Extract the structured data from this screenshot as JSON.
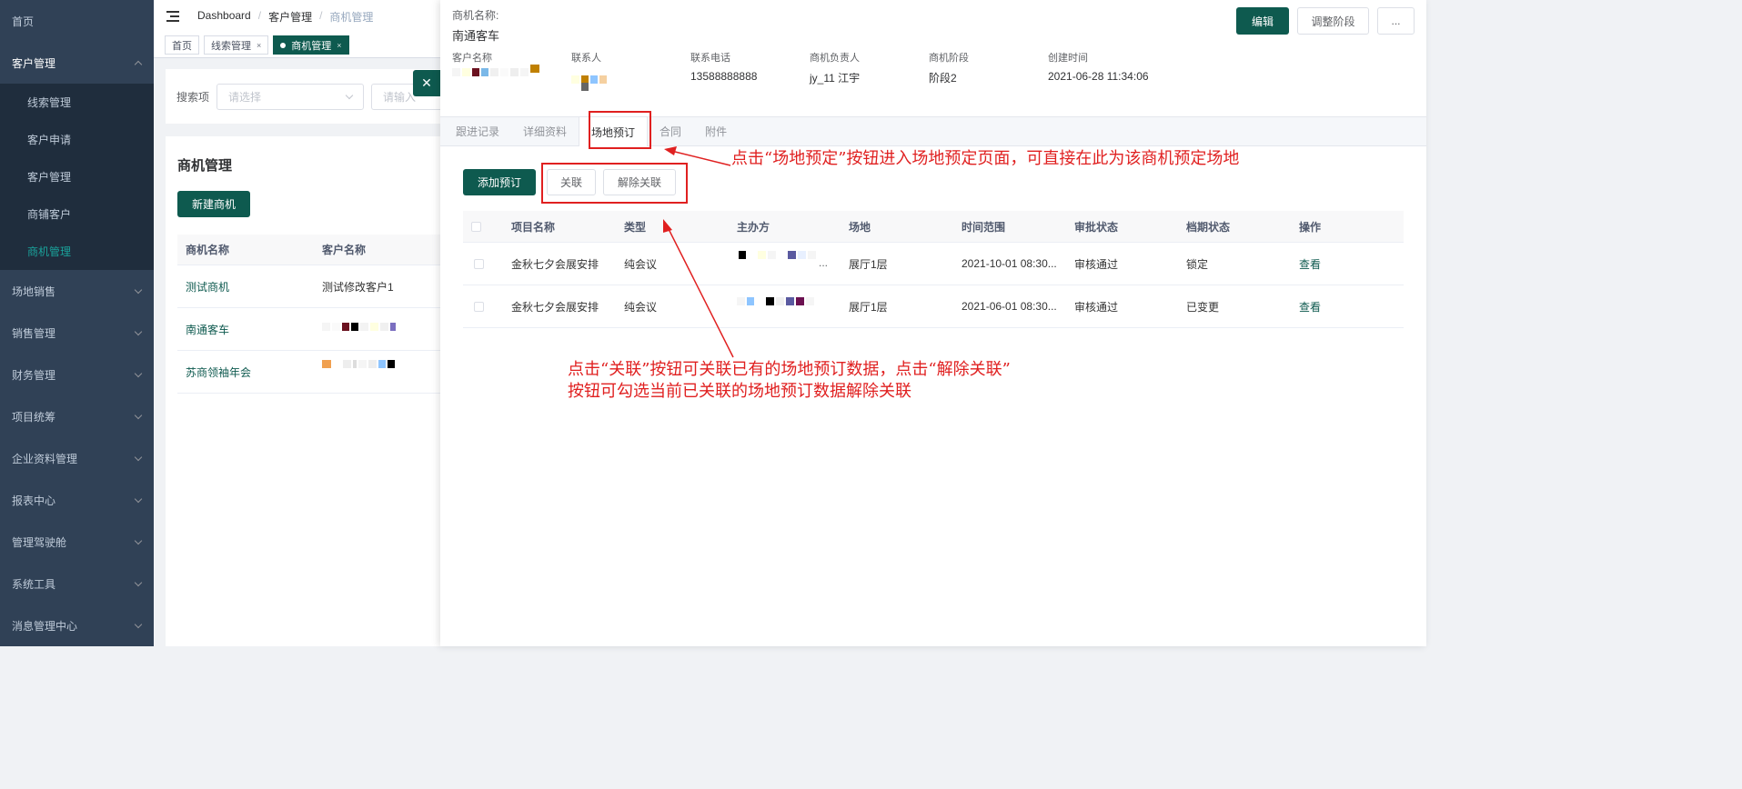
{
  "sidebar": {
    "items": [
      {
        "label": "首页"
      },
      {
        "label": "客户管理",
        "expanded": true
      },
      {
        "label": "场地销售"
      },
      {
        "label": "销售管理"
      },
      {
        "label": "财务管理"
      },
      {
        "label": "项目统筹"
      },
      {
        "label": "企业资料管理"
      },
      {
        "label": "报表中心"
      },
      {
        "label": "管理驾驶舱"
      },
      {
        "label": "系统工具"
      },
      {
        "label": "消息管理中心"
      }
    ],
    "submenu": [
      "线索管理",
      "客户申请",
      "客户管理",
      "商铺客户",
      "商机管理"
    ]
  },
  "breadcrumb": [
    "Dashboard",
    "客户管理",
    "商机管理"
  ],
  "tags": [
    "首页",
    "线索管理",
    "商机管理"
  ],
  "search": {
    "label": "搜索项",
    "select_placeholder": "请选择",
    "input_placeholder": "请输入"
  },
  "list": {
    "title": "商机管理",
    "new_button": "新建商机",
    "headers": [
      "商机名称",
      "客户名称"
    ],
    "rows": [
      {
        "name": "测试商机",
        "customer": "测试修改客户1"
      },
      {
        "name": "南通客车",
        "customer": ""
      },
      {
        "name": "苏商领袖年会",
        "customer": ""
      }
    ]
  },
  "drawer": {
    "name_label": "商机名称:",
    "name_value": "南通客车",
    "buttons": {
      "edit": "编辑",
      "adjust": "调整阶段",
      "more": "..."
    },
    "fields": {
      "customer_label": "客户名称",
      "contact_label": "联系人",
      "phone_label": "联系电话",
      "phone_value": "13588888888",
      "owner_label": "商机负责人",
      "owner_value": "jy_11 江宇",
      "stage_label": "商机阶段",
      "stage_value": "阶段2",
      "created_label": "创建时间",
      "created_value": "2021-06-28 11:34:06"
    },
    "tabs": [
      "跟进记录",
      "详细资料",
      "场地预订",
      "合同",
      "附件"
    ],
    "actions": {
      "add": "添加预订",
      "link": "关联",
      "unlink": "解除关联"
    },
    "table": {
      "headers": [
        "项目名称",
        "类型",
        "主办方",
        "场地",
        "时间范围",
        "审批状态",
        "档期状态",
        "操作"
      ],
      "rows": [
        {
          "project": "金秋七夕会展安排",
          "type": "纯会议",
          "venue": "展厅1层",
          "time": "2021-10-01 08:30...",
          "approval": "审核通过",
          "schedule": "锁定",
          "op": "查看"
        },
        {
          "project": "金秋七夕会展安排",
          "type": "纯会议",
          "venue": "展厅1层",
          "time": "2021-06-01 08:30...",
          "approval": "审核通过",
          "schedule": "已变更",
          "op": "查看"
        }
      ]
    }
  },
  "annotations": {
    "tab_note": "点击“场地预定”按钮进入场地预定页面，可直接在此为该商机预定场地",
    "link_note_line1": "点击“关联”按钮可关联已有的场地预订数据，点击“解除关联”",
    "link_note_line2": "按钮可勾选当前已关联的场地预订数据解除关联"
  },
  "colors": {
    "brand": "#0e5a4f",
    "sidebar": "#304156",
    "annotation": "#e02020"
  }
}
